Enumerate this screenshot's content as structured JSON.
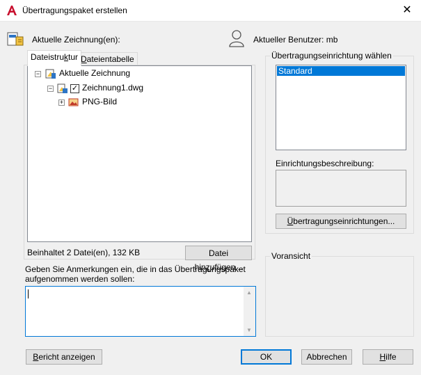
{
  "window": {
    "title": "Übertragungspaket erstellen",
    "close_symbol": "✕"
  },
  "drawings": {
    "label": "Aktuelle Zeichnung(en):",
    "user_label": "Aktueller Benutzer: mb",
    "tabs": [
      {
        "label_pre": "Dateistru",
        "label_ul": "k",
        "label_post": "tur"
      },
      {
        "label_pre": "",
        "label_ul": "D",
        "label_post": "ateientabelle"
      }
    ],
    "tree": {
      "root": "Aktuelle Zeichnung",
      "child": "Zeichnung1.dwg",
      "grandchild": "PNG-Bild",
      "child_checked": "✓"
    },
    "summary": "Beinhaltet 2 Datei(en), 132 KB",
    "add_file_button": {
      "pre": "Datei hin",
      "ul": "z",
      "post": "ufügen..."
    }
  },
  "notes": {
    "label_line1": "Geben Sie Anmerkungen ein, die in das Übertragungspaket",
    "label_line2": "aufgenommen werden sollen:",
    "value": ""
  },
  "setup": {
    "group_label": "Übertragungseinrichtung wählen",
    "items": [
      "Standard"
    ],
    "description_label": "Einrichtungsbeschreibung:",
    "description_value": "",
    "setups_button": {
      "pre": "",
      "ul": "Ü",
      "post": "bertragungseinrichtungen..."
    }
  },
  "preview": {
    "label": "Voransicht"
  },
  "buttons": {
    "report": {
      "pre": "",
      "ul": "B",
      "post": "ericht anzeigen"
    },
    "ok": "OK",
    "cancel": "Abbrechen",
    "help": {
      "pre": "",
      "ul": "H",
      "post": "ilfe"
    }
  },
  "colors": {
    "accent": "#0078d7",
    "autocad_red": "#c8102e"
  }
}
